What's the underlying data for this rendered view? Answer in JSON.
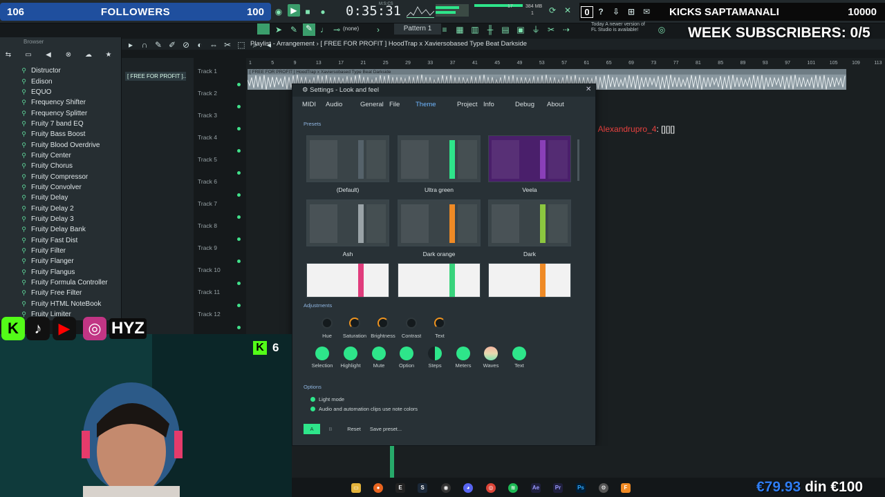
{
  "overlay": {
    "followers": {
      "current": "106",
      "label": "FOLLOWERS",
      "goal": "100"
    },
    "kicks": {
      "count": "0",
      "name": "KICKS SAPTAMANALI",
      "goal": "10000"
    },
    "week_subscribers": "WEEK SUBSCRIBERS: 0/5",
    "hyz": "HYZ",
    "kick_viewers": "6",
    "chat": {
      "user": "Alexandrupro_4",
      "message": ": [][][]"
    },
    "donation": {
      "amount": "€79.93",
      "text": " din €100"
    }
  },
  "toolbar": {
    "clock": "0:35:31",
    "clock_unit": "M:S:CS",
    "cpu_text": "17",
    "mem_text": "384 MB",
    "mem_sub": "1",
    "news_line1": "Today  A newer version of",
    "news_line2": "FL Studio is available!",
    "pattern": "Pattern 1",
    "snap": "(none)"
  },
  "browser": {
    "header": "Browser",
    "items": [
      "Distructor",
      "Edison",
      "EQUO",
      "Frequency Shifter",
      "Frequency Splitter",
      "Fruity 7 band EQ",
      "Fruity Bass Boost",
      "Fruity Blood Overdrive",
      "Fruity Center",
      "Fruity Chorus",
      "Fruity Compressor",
      "Fruity Convolver",
      "Fruity Delay",
      "Fruity Delay 2",
      "Fruity Delay 3",
      "Fruity Delay Bank",
      "Fruity Fast Dist",
      "Fruity Filter",
      "Fruity Flanger",
      "Fruity Flangus",
      "Fruity Formula Controller",
      "Fruity Free Filter",
      "Fruity HTML NoteBook",
      "Fruity Limiter"
    ]
  },
  "playlist": {
    "title": "Playlist - Arrangement  ›  [ FREE FOR PROFIT ] HoodTrap x Xaviersobased Type Beat Darkside",
    "pattern_tag": "[ FREE FOR PROFIT ]...",
    "clip_label": "[ FREE FOR PROFIT ] HoodTrap x Xaviersobased Type Beat Darkside",
    "tracks": [
      "Track 1",
      "Track 2",
      "Track 3",
      "Track 4",
      "Track 5",
      "Track 6",
      "Track 7",
      "Track 8",
      "Track 9",
      "Track 10",
      "Track 11",
      "Track 12"
    ],
    "ruler": [
      "1",
      "5",
      "9",
      "13",
      "17",
      "21",
      "25",
      "29",
      "33",
      "37",
      "41",
      "45",
      "49",
      "53",
      "57",
      "61",
      "65",
      "69",
      "73",
      "77",
      "81",
      "85",
      "89",
      "93",
      "97",
      "101",
      "105",
      "109",
      "113"
    ]
  },
  "settings": {
    "title": "Settings - Look and feel",
    "tabs": [
      "MIDI",
      "Audio",
      "General",
      "File",
      "Theme",
      "Project",
      "Info",
      "Debug",
      "About"
    ],
    "active_tab": "Theme",
    "presets_label": "Presets",
    "presets": [
      {
        "name": "(Default)",
        "accent": "#55626a"
      },
      {
        "name": "Ultra green",
        "accent": "#2ee58a"
      },
      {
        "name": "Veela",
        "accent": "#8a3fb8"
      },
      {
        "name": "Ash",
        "accent": "#9aa3a7"
      },
      {
        "name": "Dark orange",
        "accent": "#ef8a25"
      },
      {
        "name": "Dark",
        "accent": "#8cc63f"
      }
    ],
    "adjustments_label": "Adjustments",
    "knobs": [
      "Hue",
      "Saturation",
      "Brightness",
      "Contrast",
      "Text"
    ],
    "swatches": [
      "Selection",
      "Highlight",
      "Mute",
      "Option",
      "Steps",
      "Meters",
      "Waves",
      "Text"
    ],
    "options_label": "Options",
    "options": [
      "Light mode",
      "Audio and automation clips use note colors"
    ],
    "buttons": {
      "a": "A",
      "b": "B",
      "reset": "Reset",
      "save": "Save preset..."
    }
  },
  "colors": {
    "accent": "#2ee58a",
    "tab_active": "#6fb6ff",
    "followers_bar": "#1f4f9e"
  }
}
